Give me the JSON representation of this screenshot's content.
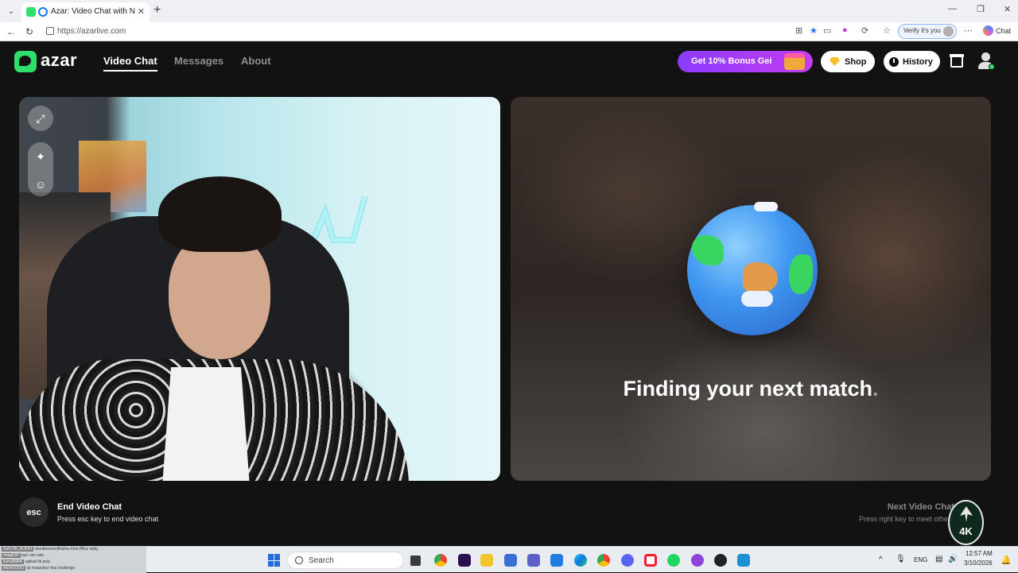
{
  "browser": {
    "tab_title": "Azar: Video Chat with New Pe",
    "url": "https://azarlive.com",
    "verify_label": "Verify it's you",
    "chat_label": "Chat"
  },
  "header": {
    "logo_text": "azar",
    "nav": [
      {
        "label": "Video Chat",
        "active": true
      },
      {
        "label": "Messages",
        "active": false
      },
      {
        "label": "About",
        "active": false
      }
    ],
    "bonus_label": "Get 10% Bonus Gei",
    "shop_label": "Shop",
    "history_label": "History"
  },
  "remote_panel": {
    "status_text": "Finding your next match",
    "status_dot": "."
  },
  "actions": {
    "esc_key": "esc",
    "end_title": "End Video Chat",
    "end_sub": "Press esc key to end video chat",
    "next_title": "Next Video Chat",
    "next_sub": "Press right key to meet other"
  },
  "watermark": {
    "label": "4K"
  },
  "taskbar": {
    "search_placeholder": "Search",
    "tray": {
      "language": "ENG",
      "time": "12:57 AM",
      "date": "3/10/2026"
    },
    "overlay_lines": [
      {
        "name": "SoFyTA_RUFIO",
        "text": "iskedbeutroxifhahsu khtu ffft1a sidiq"
      },
      {
        "name": "ImagiGR",
        "text": "pat i am xsio"
      },
      {
        "name": "kumaBIRA",
        "text": "ugikad tik puiy"
      },
      {
        "name": "RENOOOG",
        "text": "nji maarybun fxui challenge"
      }
    ]
  },
  "colors": {
    "brand_green": "#2ee06b",
    "bonus_start": "#8b3bff",
    "bonus_end": "#c43cf0",
    "page_bg": "#121212"
  }
}
